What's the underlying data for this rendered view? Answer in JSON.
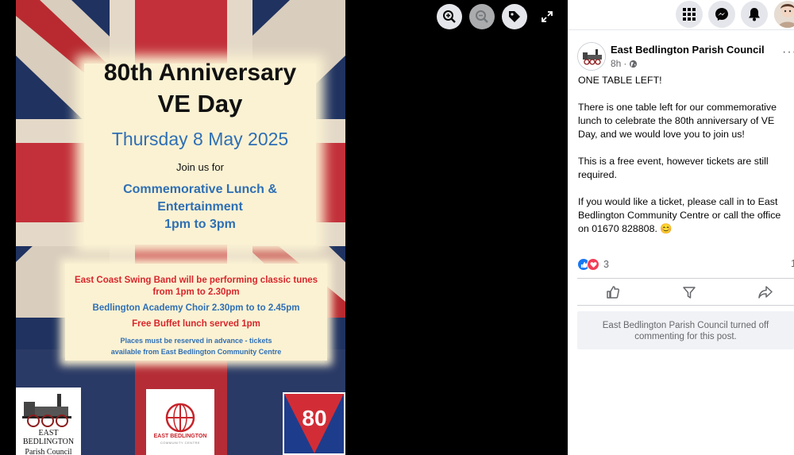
{
  "poster": {
    "title_line1": "80th Anniversary",
    "title_line2": "VE Day",
    "date": "Thursday 8 May 2025",
    "join": "Join us for",
    "event_line1": "Commemorative Lunch &",
    "event_line2": "Entertainment",
    "event_time": "1pm to 3pm",
    "band_line1": "East Coast Swing Band will be performing classic tunes",
    "band_line2": "from 1pm to 2.30pm",
    "choir": "Bedlington Academy Choir 2.30pm to  to 2.45pm",
    "buffet": "Free Buffet lunch served 1pm",
    "places_line1": "Places must be reserved in advance - tickets",
    "places_line2": "available from East Bedlington Community Centre",
    "logo1_line1": "EAST",
    "logo1_line2": "BEDLINGTON",
    "logo1_line3": "Parish Council",
    "logo2_line1": "EAST BEDLINGTON",
    "logo2_line2": "COMMUNITY CENTRE",
    "logo3_text": "80"
  },
  "viewer_controls": {
    "zoom_in_icon": "zoom-in-icon",
    "zoom_out_icon": "zoom-out-icon",
    "tag_icon": "tag-icon",
    "fullscreen_icon": "fullscreen-icon"
  },
  "topbar": {
    "menu_icon": "grid-menu-icon",
    "messenger_icon": "messenger-icon",
    "notifications_icon": "bell-icon"
  },
  "post": {
    "author": "East Bedlington Parish Council",
    "time": "8h",
    "separator": "·",
    "privacy_icon": "globe-icon",
    "more": "···",
    "paragraphs": [
      "ONE TABLE LEFT!",
      "There is one table left for our commemorative lunch to celebrate the 80th anniversary of VE Day, and we would love you to join us!",
      "This is a free event, however tickets are still required.",
      "If you would like a ticket, please call in to East Bedlington Community Centre or call the office on 01670 828808. 😊"
    ],
    "reaction_count": "3",
    "comment_count": "1",
    "actions": {
      "like_icon": "like-icon",
      "comment_icon": "comment-icon",
      "share_icon": "share-icon"
    },
    "notice": "East Bedlington Parish Council turned off commenting for this post."
  },
  "colors": {
    "accent": "#1877f2",
    "love": "#f33e58",
    "poster_blue": "#2f6fb4",
    "poster_red": "#d8262b",
    "cream": "#fbf2d3"
  }
}
